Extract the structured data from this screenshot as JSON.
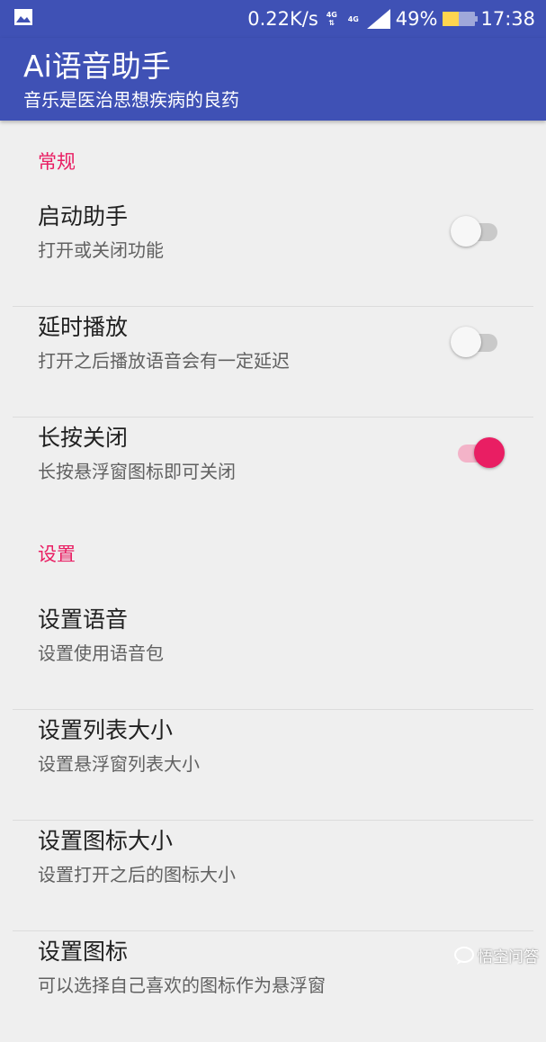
{
  "status_bar": {
    "net_speed": "0.22K/s",
    "network_label_1": "4G",
    "network_label_2": "4G",
    "battery_percent": "49%",
    "battery_level": 0.49,
    "time": "17:38",
    "icons": [
      "gallery-icon",
      "data-arrows-icon",
      "signal-icon",
      "battery-icon"
    ]
  },
  "app_bar": {
    "title": "Ai语音助手",
    "subtitle": "音乐是医治思想疾病的良药",
    "background": "#3f51b5"
  },
  "colors": {
    "accent": "#e91e63",
    "background": "#efefef",
    "title_text": "#212121",
    "summary_text": "#616161"
  },
  "categories": [
    {
      "label": "常规",
      "prefs": [
        {
          "title": "启动助手",
          "summary": "打开或关闭功能",
          "switch": false
        },
        {
          "title": "延时播放",
          "summary": "打开之后播放语音会有一定延迟",
          "switch": false
        },
        {
          "title": "长按关闭",
          "summary": "长按悬浮窗图标即可关闭",
          "switch": true
        }
      ]
    },
    {
      "label": "设置",
      "prefs": [
        {
          "title": "设置语音",
          "summary": "设置使用语音包"
        },
        {
          "title": "设置列表大小",
          "summary": "设置悬浮窗列表大小"
        },
        {
          "title": "设置图标大小",
          "summary": "设置打开之后的图标大小"
        },
        {
          "title": "设置图标",
          "summary": "可以选择自己喜欢的图标作为悬浮窗"
        }
      ]
    }
  ],
  "watermark": {
    "text": "悟空问答"
  }
}
